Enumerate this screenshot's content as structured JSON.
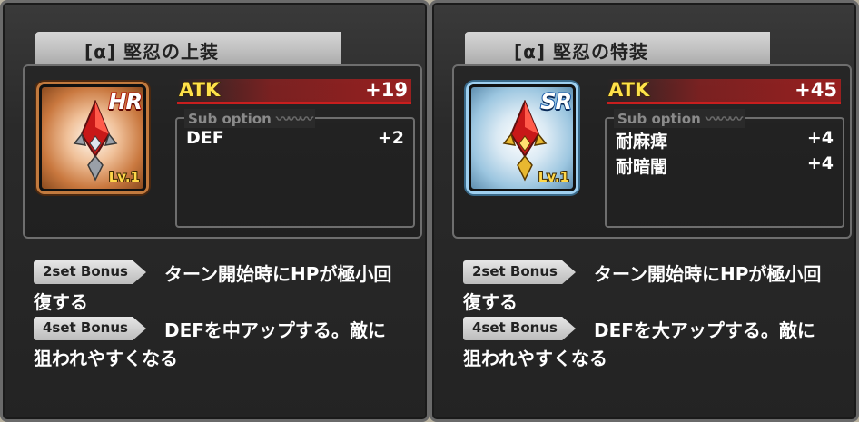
{
  "cards": [
    {
      "title": "[α] 堅忍の上装",
      "rarity": "HR",
      "level": "Lv.1",
      "icon": "red-crystal-gem-icon",
      "main_stat": {
        "name": "ATK",
        "value": "+19"
      },
      "sub_option_label": "Sub option",
      "sub_options": [
        {
          "name": "DEF",
          "value": "+2"
        }
      ],
      "bonuses": [
        {
          "tag": "2set Bonus",
          "text": "ターン開始時にHPが極小回復する"
        },
        {
          "tag": "4set Bonus",
          "text": "DEFを中アップする。敵に狙われやすくなる"
        }
      ]
    },
    {
      "title": "[α] 堅忍の特装",
      "rarity": "SR",
      "level": "Lv.1",
      "icon": "gold-red-crystal-gem-icon",
      "main_stat": {
        "name": "ATK",
        "value": "+45"
      },
      "sub_option_label": "Sub option",
      "sub_options": [
        {
          "name": "耐麻痺",
          "value": "+4"
        },
        {
          "name": "耐暗闇",
          "value": "+4"
        }
      ],
      "bonuses": [
        {
          "tag": "2set Bonus",
          "text": "ターン開始時にHPが極小回復する"
        },
        {
          "tag": "4set Bonus",
          "text": "DEFを大アップする。敵に狙われやすくなる"
        }
      ]
    }
  ]
}
